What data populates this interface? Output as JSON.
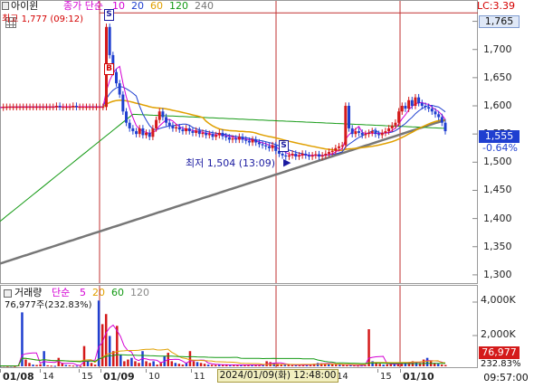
{
  "header": {
    "stock_name": "아이윈",
    "ma_label": "종가 단순",
    "ma_periods": [
      {
        "label": "10",
        "color": "#d400d4"
      },
      {
        "label": "20",
        "color": "#1f3fd0"
      },
      {
        "label": "60",
        "color": "#e0a000"
      },
      {
        "label": "120",
        "color": "#159a15"
      },
      {
        "label": "240",
        "color": "#777777"
      }
    ],
    "lc_label": "LC:3.39"
  },
  "price_panel": {
    "high_label": "최고 1,777 (09:12)",
    "low_label": "최저 1,504 (13:09)",
    "current_price_box": "1,765",
    "last_price_box": "1,555",
    "change_pct": "-0.64%",
    "signals": [
      "S",
      "B",
      "S"
    ]
  },
  "volume_panel": {
    "title": "거래량",
    "ma_label": "단순",
    "periods": [
      {
        "label": "5",
        "color": "#d400d4"
      },
      {
        "label": "20",
        "color": "#e0a000"
      },
      {
        "label": "60",
        "color": "#159a15"
      },
      {
        "label": "120",
        "color": "#888888"
      }
    ],
    "current_volume_label": "76,977주(232.83%)",
    "current_volume_box": "76,977",
    "current_volume_pct": "232.83%",
    "y_ticks": [
      "4,000K",
      "2,000K"
    ]
  },
  "x_axis": {
    "labels": [
      {
        "text": "01/08",
        "bold": true
      },
      {
        "text": "14",
        "bold": false
      },
      {
        "text": "15",
        "bold": false
      },
      {
        "text": "01/09",
        "bold": true
      },
      {
        "text": "10",
        "bold": false
      },
      {
        "text": "11",
        "bold": false
      },
      {
        "text": "14",
        "bold": false
      },
      {
        "text": "15",
        "bold": false
      },
      {
        "text": "01/10",
        "bold": true
      }
    ],
    "cursor_label": "2024/01/09(화) 12:48:00",
    "time_box": "09:57:00"
  },
  "chart_data": {
    "type": "candlestick",
    "y_ticks": [
      "1,750",
      "1,700",
      "1,650",
      "1,600",
      "1,550",
      "1,500",
      "1,450",
      "1,400",
      "1,350",
      "1,300"
    ],
    "ylim": [
      1287,
      1775
    ],
    "sessions": [
      "01/08",
      "01/09",
      "01/10"
    ],
    "price_series": [
      1597,
      1598,
      1598,
      1598,
      1598,
      1598,
      1598,
      1598,
      1598,
      1598,
      1598,
      1598,
      1598,
      1598,
      1598,
      1598,
      1598,
      1600,
      1598,
      1598,
      1598,
      1598,
      1600,
      1598,
      1598,
      1598,
      1598,
      1598,
      1598,
      1598,
      1598,
      1598,
      1740,
      1690,
      1660,
      1640,
      1620,
      1590,
      1570,
      1560,
      1555,
      1550,
      1560,
      1548,
      1552,
      1545,
      1560,
      1575,
      1590,
      1580,
      1570,
      1565,
      1560,
      1562,
      1558,
      1555,
      1560,
      1555,
      1552,
      1556,
      1550,
      1552,
      1548,
      1550,
      1545,
      1548,
      1552,
      1546,
      1544,
      1540,
      1542,
      1540,
      1545,
      1540,
      1538,
      1535,
      1540,
      1535,
      1532,
      1530,
      1528,
      1525,
      1530,
      1520,
      1515,
      1512,
      1510,
      1512,
      1515,
      1510,
      1512,
      1515,
      1512,
      1510,
      1512,
      1514,
      1510,
      1512,
      1515,
      1518,
      1520,
      1525,
      1528,
      1530,
      1600,
      1560,
      1550,
      1555,
      1552,
      1548,
      1550,
      1552,
      1555,
      1550,
      1548,
      1552,
      1555,
      1560,
      1565,
      1570,
      1590,
      1600,
      1595,
      1610,
      1600,
      1615,
      1605,
      1600,
      1598,
      1595,
      1590,
      1585,
      1580,
      1570,
      1555
    ],
    "volume_series": [
      20,
      30,
      15,
      25,
      10,
      60,
      3200,
      400,
      200,
      100,
      80,
      120,
      900,
      60,
      40,
      30,
      500,
      200,
      80,
      60,
      40,
      30,
      20,
      1200,
      300,
      200,
      100,
      3900,
      2500,
      3100,
      1800,
      900,
      2400,
      700,
      300,
      400,
      500,
      300,
      200,
      900,
      300,
      200,
      300,
      100,
      200,
      600,
      800,
      300,
      200,
      150,
      100,
      200,
      900,
      300,
      250,
      200,
      150,
      100,
      90,
      80,
      120,
      100,
      80,
      60,
      70,
      90,
      100,
      80,
      60,
      70,
      80,
      90,
      100,
      300,
      250,
      200,
      150,
      100,
      80,
      90,
      70,
      60,
      80,
      90,
      100,
      120,
      150,
      200,
      180,
      160,
      140,
      120,
      100,
      90,
      80,
      70,
      60,
      50,
      40,
      50,
      60,
      2200,
      300,
      200,
      150,
      100,
      120,
      140,
      160,
      180,
      200,
      220,
      250,
      300,
      250,
      200,
      400,
      500,
      300,
      200,
      150,
      100,
      77
    ]
  }
}
